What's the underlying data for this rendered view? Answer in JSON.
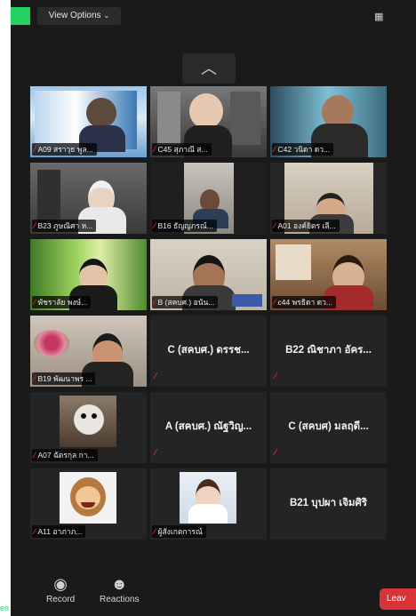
{
  "toolbar_top": {
    "view_options": "View Options"
  },
  "participants": [
    {
      "name": "A09 สราวุธ พูล..."
    },
    {
      "name": "C45 สุภาณี ส..."
    },
    {
      "name": "C42 วนิดา ดว..."
    },
    {
      "name": "B23 ภูษณิศา ห..."
    },
    {
      "name": "B16 ธัญญภรณ์..."
    },
    {
      "name": "A01 องค์ยิตร เลี..."
    },
    {
      "name": "พัชราลัย พงษ์..."
    },
    {
      "name": "B (สคบศ.) อนัน..."
    },
    {
      "name": "c44 พรธิดา ดว..."
    },
    {
      "name": "B19 พัฒนาพร ..."
    },
    {
      "name": "C (สคบศ.) ดรรช..."
    },
    {
      "name": "B22 ณิชาภา อัคร..."
    },
    {
      "name": "A07 ฉัตรกุล กา..."
    },
    {
      "name": "A (สคบศ.) ณัฐวิญ..."
    },
    {
      "name": "C (สคบศ) มลฤดี..."
    },
    {
      "name": "A11 อาภาภ..."
    },
    {
      "name": "ผู้สังเกตการณ์"
    },
    {
      "name": "B21 บุปผา เจิมศิริ"
    }
  ],
  "bottom": {
    "record": "Record",
    "reactions": "Reactions",
    "leave": "Leav",
    "left_label": "en"
  }
}
